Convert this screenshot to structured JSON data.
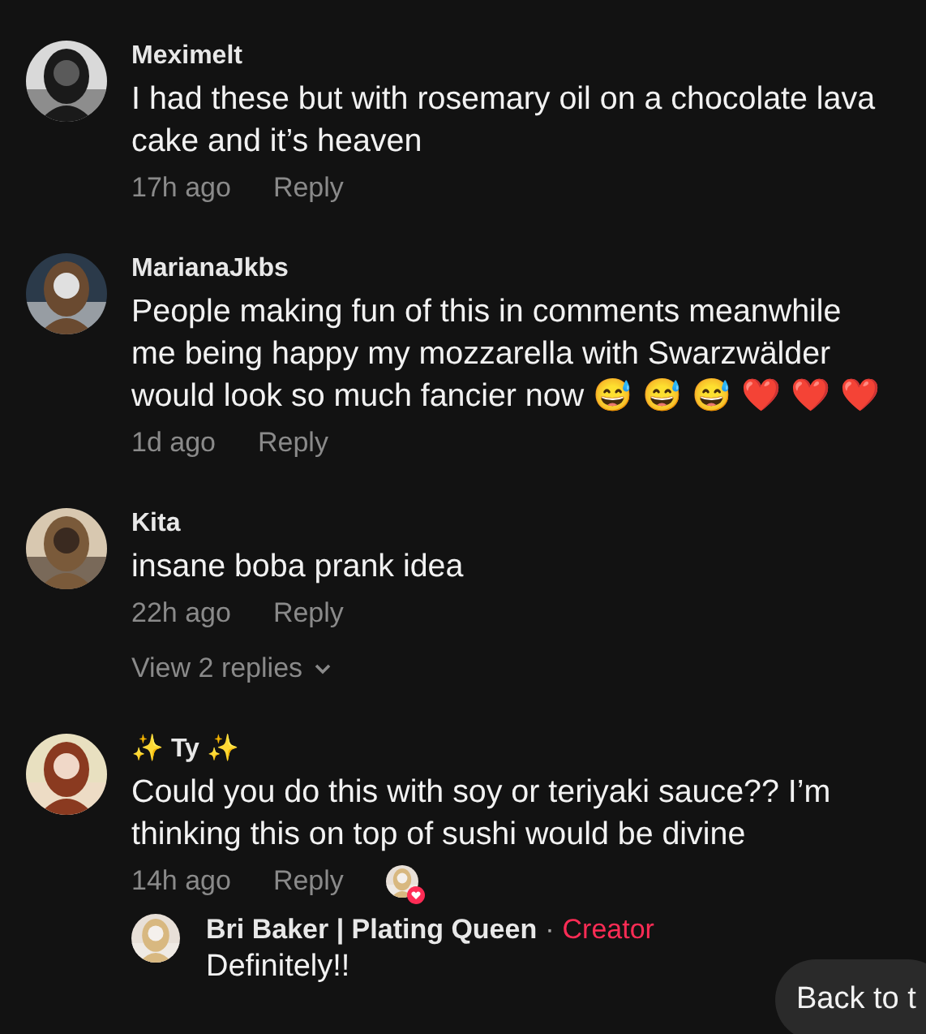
{
  "comments": [
    {
      "username": "Meximelt",
      "text": "I had these but with rosemary oil on a chocolate lava cake and it’s heaven",
      "time": "17h ago",
      "reply_label": "Reply",
      "creator_liked": false
    },
    {
      "username": "MarianaJkbs",
      "text": "People making fun of this in comments meanwhile me being happy my mozzarella with Swarzwälder would look so much fancier now 😅 😅 😅 ❤️ ❤️ ❤️",
      "time": "1d ago",
      "reply_label": "Reply",
      "creator_liked": false
    },
    {
      "username": "Kita",
      "text": "insane boba prank idea",
      "time": "22h ago",
      "reply_label": "Reply",
      "creator_liked": false,
      "view_replies": "View 2 replies"
    },
    {
      "username": "✨ Ty ✨",
      "text": "Could you do this with soy or teriyaki sauce?? I’m thinking this on top of sushi would be divine",
      "time": "14h ago",
      "reply_label": "Reply",
      "creator_liked": true,
      "replies": [
        {
          "username": "Bri Baker | Plating Queen",
          "separator": "·",
          "badge": "Creator",
          "text": "Definitely!!"
        }
      ]
    }
  ],
  "back_button": "Back to t"
}
